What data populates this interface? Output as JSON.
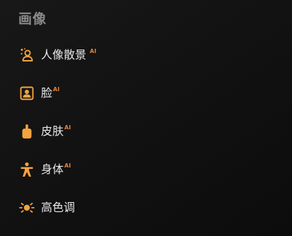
{
  "section": {
    "title": "画像"
  },
  "items": [
    {
      "label": "人像散景",
      "badge": "AI",
      "icon": "person-bokeh-icon"
    },
    {
      "label": "脸",
      "badge": "AI",
      "icon": "face-icon"
    },
    {
      "label": "皮肤",
      "badge": "AI",
      "icon": "skin-icon"
    },
    {
      "label": "身体",
      "badge": "AI",
      "icon": "body-icon"
    },
    {
      "label": "高色调",
      "icon": "high-key-icon"
    }
  ],
  "colors": {
    "icon": "#f3a33f",
    "badge": "#e0813a",
    "title": "#8a8a8a",
    "text": "#e8e8e8"
  }
}
